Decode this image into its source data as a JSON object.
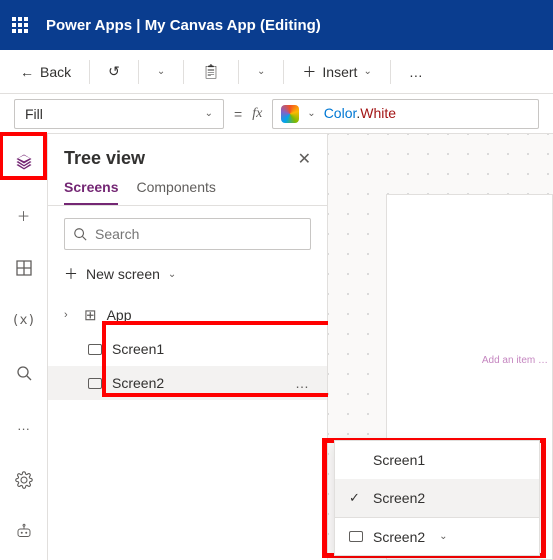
{
  "titlebar": {
    "product": "Power Apps",
    "sep": "  |  ",
    "doc": "My Canvas App (Editing)"
  },
  "cmdbar": {
    "back": "Back",
    "insert": "Insert"
  },
  "formula": {
    "property": "Fill",
    "token_type": "Color",
    "token_dot": ".",
    "token_val": "White"
  },
  "rail": {
    "icons": [
      "tree-view-icon",
      "insert-icon",
      "data-icon",
      "variables-icon",
      "search-icon",
      "more-icon"
    ]
  },
  "tree": {
    "title": "Tree view",
    "tabs": {
      "screens": "Screens",
      "components": "Components"
    },
    "search_placeholder": "Search",
    "newscreen": "New screen",
    "app": "App",
    "items": [
      {
        "label": "Screen1",
        "selected": false
      },
      {
        "label": "Screen2",
        "selected": true
      }
    ]
  },
  "canvas": {
    "hint": "Add an item …"
  },
  "menu": {
    "items": [
      {
        "label": "Screen1",
        "checked": false,
        "icon": false
      },
      {
        "label": "Screen2",
        "checked": true,
        "icon": false
      },
      {
        "label": "Screen2",
        "checked": false,
        "icon": true
      }
    ]
  }
}
